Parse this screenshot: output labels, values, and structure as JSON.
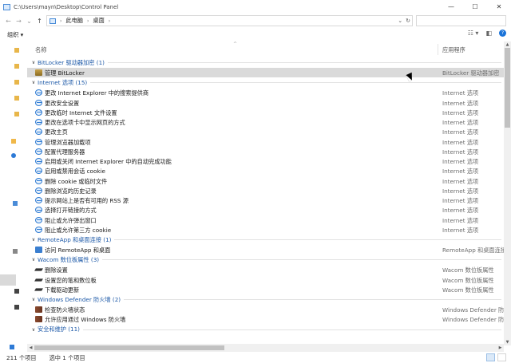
{
  "window": {
    "title": "C:\\Users\\mayn\\Desktop\\Control Panel",
    "minimize": "—",
    "maximize": "☐",
    "close": "✕"
  },
  "address": {
    "back": "←",
    "forward": "→",
    "recent": "⌄",
    "up": "↑",
    "crumbs": [
      "此电脑",
      "桌面"
    ],
    "refresh": "↻",
    "search_placeholder": ""
  },
  "toolbar": {
    "organize": "组织 ▾"
  },
  "columns": {
    "name": "名称",
    "app": "应用程序"
  },
  "groups": [
    {
      "title": "BitLocker 驱动器加密 (1)",
      "icon": "bitlocker-icon",
      "items": [
        {
          "name": "管理 BitLocker",
          "app": "BitLocker 驱动器加密",
          "selected": true
        }
      ]
    },
    {
      "title": "Internet 选项 (15)",
      "icon": "internet-options-icon",
      "items": [
        {
          "name": "更改 Internet Explorer 中的搜索提供商",
          "app": "Internet 选项"
        },
        {
          "name": "更改安全设置",
          "app": "Internet 选项"
        },
        {
          "name": "更改临时 Internet 文件设置",
          "app": "Internet 选项"
        },
        {
          "name": "更改在选项卡中显示网页的方式",
          "app": "Internet 选项"
        },
        {
          "name": "更改主页",
          "app": "Internet 选项"
        },
        {
          "name": "管理浏览器加载项",
          "app": "Internet 选项"
        },
        {
          "name": "配置代理服务器",
          "app": "Internet 选项"
        },
        {
          "name": "启用或关闭 Internet Explorer 中的自动完成功能",
          "app": "Internet 选项"
        },
        {
          "name": "启用或禁用会话 cookie",
          "app": "Internet 选项"
        },
        {
          "name": "删除 cookie 或临时文件",
          "app": "Internet 选项"
        },
        {
          "name": "删除浏览的历史记录",
          "app": "Internet 选项"
        },
        {
          "name": "提示网站上是否有可用的 RSS 源",
          "app": "Internet 选项"
        },
        {
          "name": "选择打开链接的方式",
          "app": "Internet 选项"
        },
        {
          "name": "阻止或允许弹出窗口",
          "app": "Internet 选项"
        },
        {
          "name": "阻止或允许第三方 cookie",
          "app": "Internet 选项"
        }
      ]
    },
    {
      "title": "RemoteApp 和桌面连接 (1)",
      "icon": "remoteapp-icon",
      "items": [
        {
          "name": "访问 RemoteApp 和桌面",
          "app": "RemoteApp 和桌面连接"
        }
      ]
    },
    {
      "title": "Wacom 数位板属性 (3)",
      "icon": "wacom-pen-icon",
      "items": [
        {
          "name": "删除设置",
          "app": "Wacom 数位板属性"
        },
        {
          "name": "设置您的笔和数位板",
          "app": "Wacom 数位板属性"
        },
        {
          "name": "下载驱动更新",
          "app": "Wacom 数位板属性"
        }
      ]
    },
    {
      "title": "Windows Defender 防火墙 (2)",
      "icon": "firewall-icon",
      "items": [
        {
          "name": "检查防火墙状态",
          "app": "Windows Defender 防火墙"
        },
        {
          "name": "允许应用通过 Windows 防火墙",
          "app": "Windows Defender 防火墙"
        }
      ]
    },
    {
      "title": "安全和维护 (11)",
      "icon": "security-icon",
      "items": []
    }
  ],
  "status": {
    "count": "211 个项目",
    "selected": "选中 1 个项目"
  }
}
